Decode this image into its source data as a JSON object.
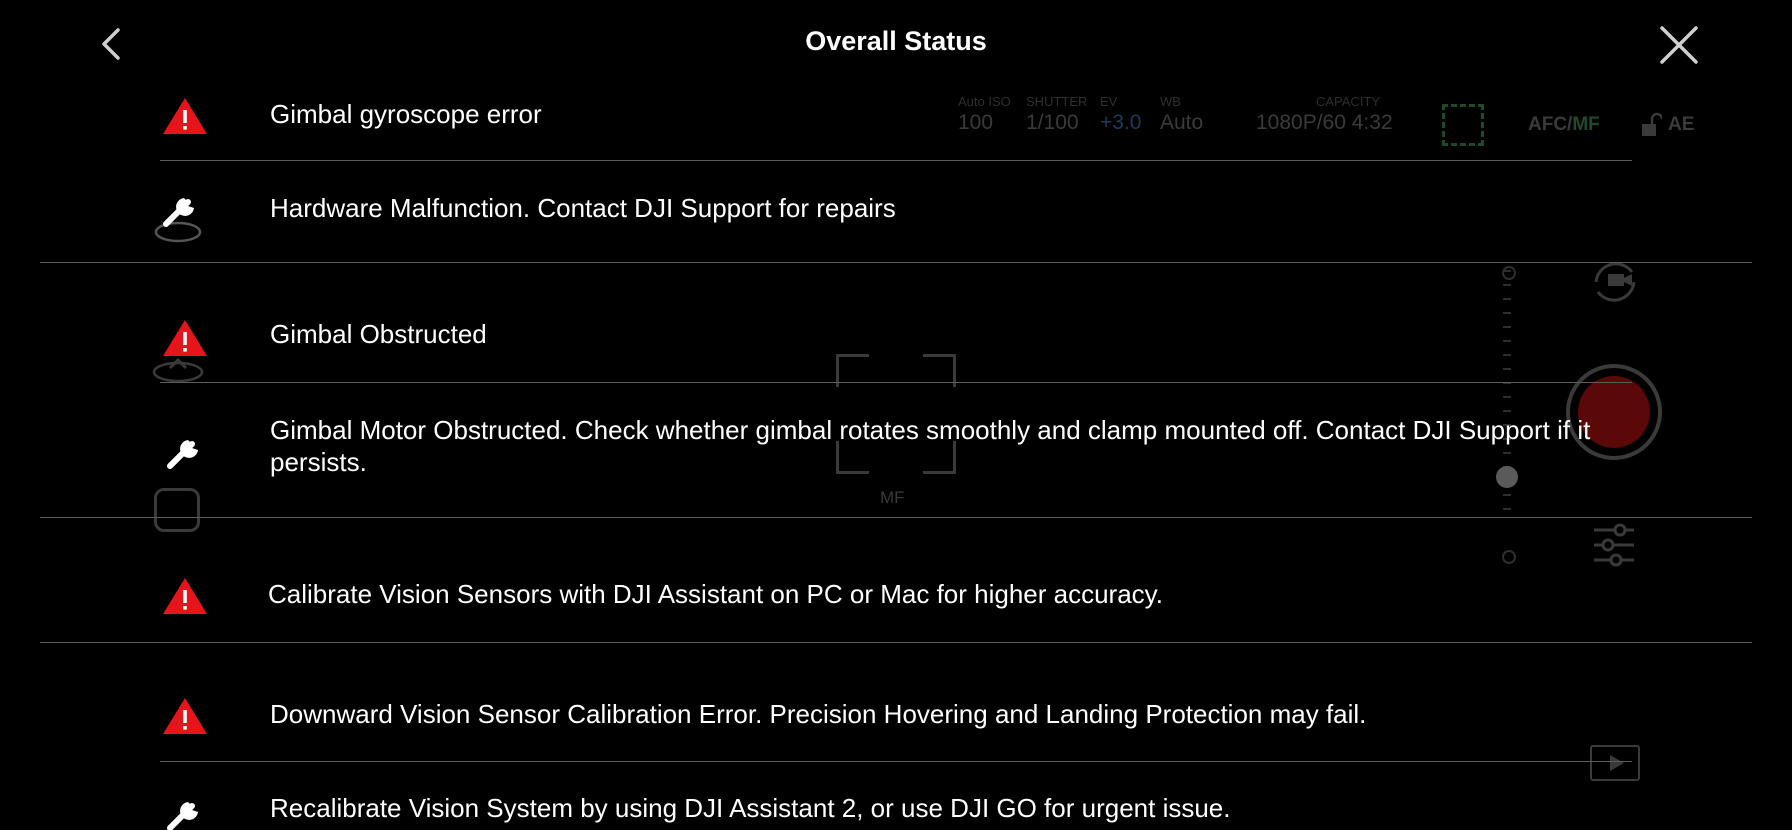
{
  "header": {
    "title": "Overall Status"
  },
  "camera_overlay": {
    "stats": [
      {
        "label": "Auto ISO",
        "value": "100"
      },
      {
        "label": "SHUTTER",
        "value": "1/100"
      },
      {
        "label": "EV",
        "value": "+3.0"
      },
      {
        "label": "WB",
        "value": "Auto"
      },
      {
        "label": "CAPACITY",
        "value": "1080P/60 4:32"
      }
    ],
    "focus_mode_afc": "AFC/",
    "focus_mode_mf": "MF",
    "exposure_lock": "AE",
    "frame_label": "MF"
  },
  "status_items": [
    {
      "icon": "warning-icon",
      "text": "Gimbal gyroscope error"
    },
    {
      "icon": "wrench-icon",
      "text": "Hardware Malfunction. Contact DJI Support for repairs"
    },
    {
      "icon": "warning-icon",
      "text": "Gimbal Obstructed"
    },
    {
      "icon": "wrench-icon",
      "text": "Gimbal Motor Obstructed. Check whether gimbal rotates smoothly and clamp mounted off. Contact DJI Support if it persists."
    },
    {
      "icon": "warning-icon",
      "text": "Calibrate Vision Sensors with DJI Assistant on PC or Mac for higher accuracy."
    },
    {
      "icon": "warning-icon",
      "text": "Downward Vision Sensor Calibration Error. Precision Hovering and Landing Protection may fail."
    },
    {
      "icon": "wrench-icon",
      "text": "Recalibrate Vision System by using DJI Assistant 2, or use DJI GO for urgent issue."
    }
  ],
  "colors": {
    "warning": "#e8141c",
    "background": "#000000",
    "text": "#ffffff",
    "divider": "#5c5c5c"
  }
}
